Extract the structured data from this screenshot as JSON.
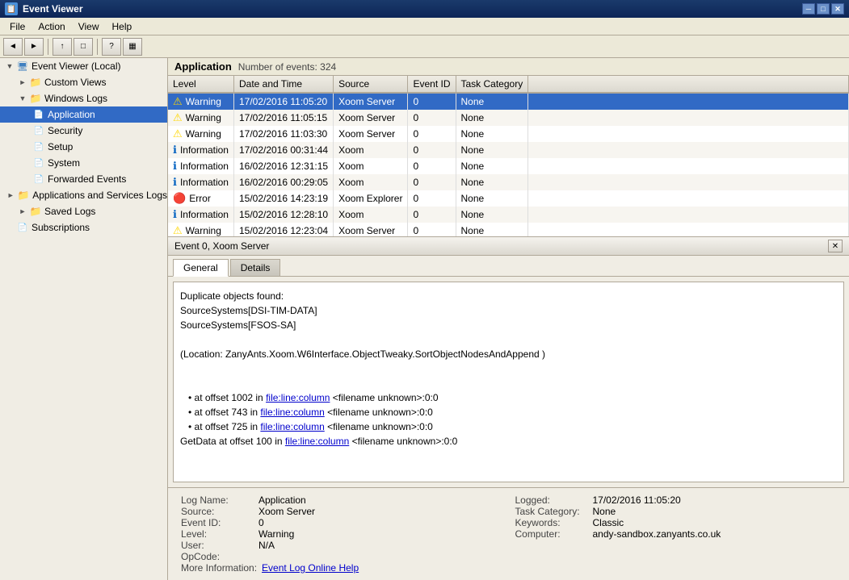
{
  "titlebar": {
    "title": "Event Viewer",
    "close": "✕",
    "minimize": "─",
    "maximize": "□"
  },
  "menubar": {
    "items": [
      "File",
      "Action",
      "View",
      "Help"
    ]
  },
  "toolbar": {
    "buttons": [
      "◄",
      "►",
      "↑",
      "□",
      "?",
      "▦"
    ]
  },
  "sidebar": {
    "root_label": "Event Viewer (Local)",
    "custom_views_label": "Custom Views",
    "windows_logs_label": "Windows Logs",
    "logs": [
      {
        "label": "Application",
        "selected": true
      },
      {
        "label": "Security",
        "selected": false
      },
      {
        "label": "Setup",
        "selected": false
      },
      {
        "label": "System",
        "selected": false
      },
      {
        "label": "Forwarded Events",
        "selected": false
      }
    ],
    "app_services_label": "Applications and Services Logs",
    "saved_logs_label": "Saved Logs",
    "subscriptions_label": "Subscriptions"
  },
  "event_list": {
    "app_label": "Application",
    "event_count_label": "Number of events: 324",
    "columns": [
      "Level",
      "Date and Time",
      "Source",
      "Event ID",
      "Task Category"
    ],
    "rows": [
      {
        "level": "Warning",
        "level_type": "warn",
        "datetime": "17/02/2016 11:05:20",
        "source": "Xoom Server",
        "event_id": "0",
        "category": "None",
        "selected": true
      },
      {
        "level": "Warning",
        "level_type": "warn",
        "datetime": "17/02/2016 11:05:15",
        "source": "Xoom Server",
        "event_id": "0",
        "category": "None",
        "selected": false
      },
      {
        "level": "Warning",
        "level_type": "warn",
        "datetime": "17/02/2016 11:03:30",
        "source": "Xoom Server",
        "event_id": "0",
        "category": "None",
        "selected": false
      },
      {
        "level": "Information",
        "level_type": "info",
        "datetime": "17/02/2016 00:31:44",
        "source": "Xoom",
        "event_id": "0",
        "category": "None",
        "selected": false
      },
      {
        "level": "Information",
        "level_type": "info",
        "datetime": "16/02/2016 12:31:15",
        "source": "Xoom",
        "event_id": "0",
        "category": "None",
        "selected": false
      },
      {
        "level": "Information",
        "level_type": "info",
        "datetime": "16/02/2016 00:29:05",
        "source": "Xoom",
        "event_id": "0",
        "category": "None",
        "selected": false
      },
      {
        "level": "Error",
        "level_type": "error",
        "datetime": "15/02/2016 14:23:19",
        "source": "Xoom Explorer",
        "event_id": "0",
        "category": "None",
        "selected": false
      },
      {
        "level": "Information",
        "level_type": "info",
        "datetime": "15/02/2016 12:28:10",
        "source": "Xoom",
        "event_id": "0",
        "category": "None",
        "selected": false
      },
      {
        "level": "Warning",
        "level_type": "warn",
        "datetime": "15/02/2016 12:23:04",
        "source": "Xoom Server",
        "event_id": "0",
        "category": "None",
        "selected": false
      },
      {
        "level": "Information",
        "level_type": "info",
        "datetime": "15/02/2016 00:27:20",
        "source": "Xoom",
        "event_id": "0",
        "category": "None",
        "selected": false
      }
    ]
  },
  "detail_panel": {
    "title": "Event 0, Xoom Server",
    "tabs": [
      "General",
      "Details"
    ],
    "active_tab": "General",
    "message": "Duplicate objects found:\nSourceSystems[DSI-TIM-DATA]\nSourceSystems[FSOS-SA]\n\n(Location: ZanyAnts.Xoom.W6Interface.ObjectTweaky.SortObjectNodesAndAppend )\n\n\n\n   • at offset 1002 in file:line:column <filename unknown>:0:0\n   • at offset 743 in file:line:column <filename unknown>:0:0\n   • at offset 725 in file:line:column <filename unknown>:0:0\nGetData at offset 100 in file:line:column <filename unknown>:0:0",
    "fields": {
      "log_name_label": "Log Name:",
      "log_name_value": "Application",
      "source_label": "Source:",
      "source_value": "Xoom Server",
      "event_id_label": "Event ID:",
      "event_id_value": "0",
      "level_label": "Level:",
      "level_value": "Warning",
      "user_label": "User:",
      "user_value": "N/A",
      "opcode_label": "OpCode:",
      "opcode_value": "",
      "more_info_label": "More Information:",
      "more_info_link": "Event Log Online Help",
      "logged_label": "Logged:",
      "logged_value": "17/02/2016 11:05:20",
      "task_category_label": "Task Category:",
      "task_category_value": "None",
      "keywords_label": "Keywords:",
      "keywords_value": "Classic",
      "computer_label": "Computer:",
      "computer_value": "andy-sandbox.zanyants.co.uk"
    }
  }
}
